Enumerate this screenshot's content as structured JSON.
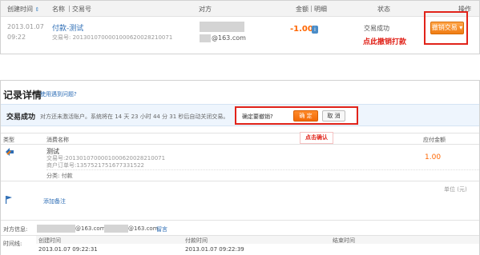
{
  "top_table": {
    "headers": {
      "created": "创建时间",
      "name": "名称",
      "trade_no": "交易号",
      "counterparty": "对方",
      "amount": "金额",
      "detail": "明细",
      "status": "状态",
      "action": "操作"
    },
    "row": {
      "date": "2013.01.07",
      "time": "09:22",
      "title": "付款-测试",
      "trade_label": "交易号:",
      "trade_no": "2013010700001000620028210071",
      "email_suffix": "@163.com",
      "amount": "-1.00",
      "status": "交易成功",
      "cancel_button": "撤销交易",
      "cancel_hint": "点此撤销打款"
    }
  },
  "detail": {
    "title": "记录详情",
    "help_link": "使用遇到问题?",
    "success_label": "交易成功",
    "success_msg": "对方还未激活账户。系统将在 14 天 23 小时 44 分 31 秒后自动关闭交易。",
    "confirm_prompt": "确定要撤销?",
    "confirm_button": "确 定",
    "cancel_button": "取 消",
    "confirm_hint": "点击确认",
    "columns": {
      "type": "类型",
      "name": "消费名称",
      "amount": "应付金额"
    },
    "item": {
      "name": "测试",
      "trade_label": "交易号:",
      "trade_no": "2013010700001000620028210071",
      "order_label": "商户订单号:",
      "order_no": "1357521751677331522",
      "category_label": "分类:",
      "category": "付款",
      "amount": "1.00"
    },
    "unit": "单位 (元)",
    "add_note": "添加备注",
    "party_label": "对方信息:",
    "party_email_1": "@163.com",
    "party_email_2": "@163.com",
    "party_link": "留言",
    "timeline_label": "时间线:",
    "timeline": [
      {
        "label": "创建时间",
        "value": "2013.01.07 09:22:31"
      },
      {
        "label": "付款时间",
        "value": "2013.01.07 09:22:39"
      },
      {
        "label": "结束时间",
        "value": ""
      }
    ]
  },
  "colors": {
    "accent_red": "#e1231a",
    "amount_orange": "#ff6600",
    "link_blue": "#2d6db5",
    "button_orange": "#f07d14"
  }
}
